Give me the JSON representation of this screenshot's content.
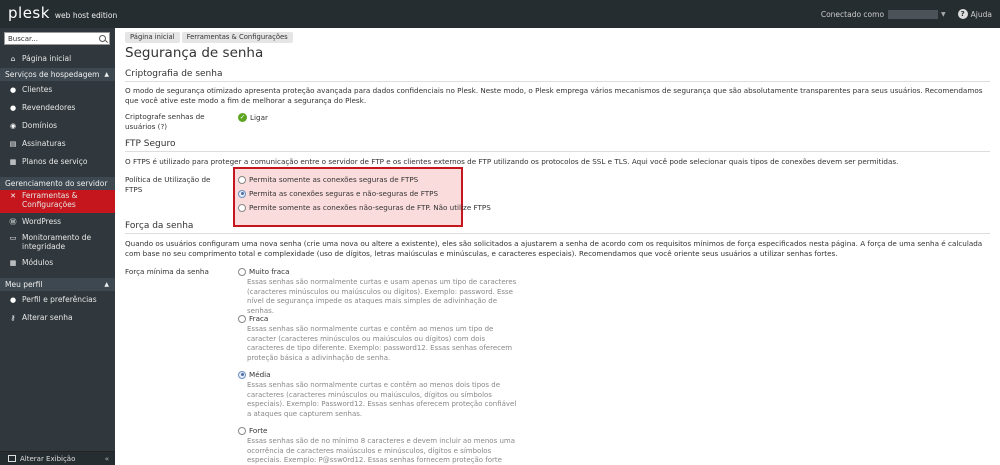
{
  "header": {
    "logo": "plesk",
    "edition": "web host edition",
    "connected_as": "Conectado como",
    "help": "Ajuda"
  },
  "sidebar": {
    "search_placeholder": "Buscar...",
    "home": "Página inicial",
    "sections": [
      {
        "title": "Serviços de hospedagem",
        "items": [
          "Clientes",
          "Revendedores",
          "Domínios",
          "Assinaturas",
          "Planos de serviço"
        ]
      },
      {
        "title": "Gerenciamento do servidor",
        "items": [
          "Ferramentas & Configurações",
          "WordPress",
          "Monitoramento de integridade",
          "Módulos"
        ]
      },
      {
        "title": "Meu perfil",
        "items": [
          "Perfil e preferências",
          "Alterar senha"
        ]
      }
    ],
    "footer": "Alterar Exibição"
  },
  "breadcrumbs": [
    "Página inicial",
    "Ferramentas & Configurações"
  ],
  "page_title": "Segurança de senha",
  "encryption": {
    "title": "Criptografia de senha",
    "description": "O modo de segurança otimizado apresenta proteção avançada para dados confidenciais no Plesk. Neste modo, o Plesk emprega vários mecanismos de segurança que são absolutamente transparentes para seus usuários. Recomendamos que você ative este modo a fim de melhorar a segurança do Plesk.",
    "label": "Criptografe senhas de usuários (?)",
    "value": "Ligar"
  },
  "ftp": {
    "title": "FTP Seguro",
    "description": "O FTPS é utilizado para proteger a comunicação entre o servidor de FTP e os clientes externos de FTP utilizando os protocolos de SSL e TLS. Aqui você pode selecionar quais tipos de conexões devem ser permitidas.",
    "label": "Política de Utilização de FTPS",
    "options": [
      "Permita somente as conexões seguras de FTPS",
      "Permita as conexões seguras e não-seguras de FTPS",
      "Permite somente as conexões não-seguras de FTP. Não utilize FTPS"
    ],
    "selected": 1
  },
  "strength": {
    "title": "Força da senha",
    "description": "Quando os usuários configuram uma nova senha (crie uma nova ou altere a existente), eles são solicitados a ajustarem a senha de acordo com os requisitos mínimos de força especificados nesta página. A força de uma senha é calculada com base no seu comprimento total e complexidade (uso de dígitos, letras maiúsculas e minúsculas, e caracteres especiais). Recomendamos que você oriente seus usuários a utilizar senhas fortes.",
    "label": "Força mínima da senha",
    "options": [
      {
        "name": "Muito fraca",
        "desc": "Essas senhas são normalmente curtas e usam apenas um tipo de caracteres (caracteres minúsculos ou maiúsculos ou dígitos). Exemplo: password. Esse nível de segurança impede os ataques mais simples de adivinhação de senhas."
      },
      {
        "name": "Fraca",
        "desc": "Essas senhas são normalmente curtas e contêm ao menos um tipo de caracter (caracteres minúsculos ou maiúsculos ou dígitos) com dois caracteres de tipo diferente. Exemplo: password12. Essas senhas oferecem proteção básica a adivinhação de senha."
      },
      {
        "name": "Média",
        "desc": "Essas senhas são normalmente curtas e contêm ao menos dois tipos de caracteres (caracteres minúsculos ou maiúsculos, dígitos ou símbolos especiais). Exemplo: Password12. Essas senhas oferecem proteção confiável a ataques que capturem senhas."
      },
      {
        "name": "Forte",
        "desc": "Essas senhas são de no mínimo 8 caracteres e devem incluir ao menos uma ocorrência de caracteres maiúsculos e minúsculos, dígitos e símbolos especiais. Exemplo: P@ssw0rd12. Essas senhas fornecem proteção forte contra ataques de"
      }
    ],
    "selected": 2
  }
}
